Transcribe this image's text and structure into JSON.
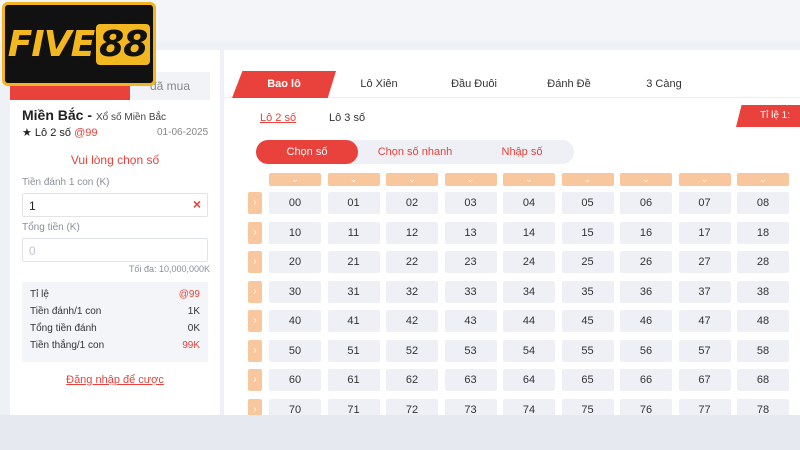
{
  "logo": {
    "text": "FIVE",
    "number": "88"
  },
  "left_panel": {
    "tab_inactive": "đã mua",
    "region": "Miền Bắc -",
    "region_sub": "Xổ số Miền Bắc",
    "bet_type": "★ Lô 2 số",
    "bet_rate": "@99",
    "date": "01-06-2025",
    "pick_prompt": "Vui lòng chọn số",
    "amount_label": "Tiền đánh 1 con (K)",
    "amount_value": "1",
    "clear_icon": "×",
    "total_label": "Tổng tiền (K)",
    "total_placeholder": "0",
    "max_note": "Tối đa: 10,000,000K",
    "summary": [
      {
        "label": "Tỉ lệ",
        "value": "@99",
        "red": true
      },
      {
        "label": "Tiền đánh/1 con",
        "value": "1K",
        "red": false
      },
      {
        "label": "Tổng tiền đánh",
        "value": "0K",
        "red": false
      },
      {
        "label": "Tiền thắng/1 con",
        "value": "99K",
        "red": true
      }
    ],
    "login_link": "Đăng nhập để cược"
  },
  "main_tabs": [
    "Bao lô",
    "Lô Xiên",
    "Đầu Đuôi",
    "Đánh Đề",
    "3 Càng"
  ],
  "sub_tabs": [
    "Lô 2 số",
    "Lô 3 số"
  ],
  "rate_badge": "Tỉ lệ 1:",
  "modes": [
    "Chọn số",
    "Chọn số nhanh",
    "Nhập số"
  ],
  "grid": {
    "column_chevron": "⌄",
    "row_arrow": "›",
    "rows": [
      [
        "00",
        "01",
        "02",
        "03",
        "04",
        "05",
        "06",
        "07",
        "08"
      ],
      [
        "10",
        "11",
        "12",
        "13",
        "14",
        "15",
        "16",
        "17",
        "18"
      ],
      [
        "20",
        "21",
        "22",
        "23",
        "24",
        "25",
        "26",
        "27",
        "28"
      ],
      [
        "30",
        "31",
        "32",
        "33",
        "34",
        "35",
        "36",
        "37",
        "38"
      ],
      [
        "40",
        "41",
        "42",
        "43",
        "44",
        "45",
        "46",
        "47",
        "48"
      ],
      [
        "50",
        "51",
        "52",
        "53",
        "54",
        "55",
        "56",
        "57",
        "58"
      ],
      [
        "60",
        "61",
        "62",
        "63",
        "64",
        "65",
        "66",
        "67",
        "68"
      ],
      [
        "70",
        "71",
        "72",
        "73",
        "74",
        "75",
        "76",
        "77",
        "78"
      ]
    ]
  },
  "colors": {
    "accent": "#e9413b",
    "header_cell": "#f9c79e",
    "cell": "#eef0f5",
    "logo_gold": "#f3b81f"
  }
}
